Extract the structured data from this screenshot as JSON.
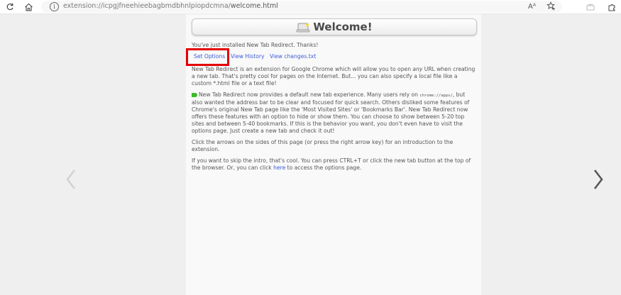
{
  "browser": {
    "url_prefix": "extension://icpgjfneehieebagbmdbhnlpiopdcmna/",
    "url_path": "welcome.html",
    "read_aloud_label": "Aᴬ"
  },
  "header": {
    "title": "Welcome!"
  },
  "intro": {
    "text": "You've just installed New Tab Redirect. Thanks!"
  },
  "links": {
    "set_options": "Set Options",
    "view_history": "View History",
    "view_changes": "View changes.txt"
  },
  "paragraphs": {
    "p1_a": "New Tab Redirect is an extension for Google Chrome which will allow you to open ",
    "p1_em": "any",
    "p1_b": " URL when creating a new tab. That's pretty cool for pages on the Internet. But... you can also specify a local file like a custom *.html file or a text file!",
    "p2_a": "New Tab Redirect now provides a default new tab experience. Many users rely on ",
    "p2_code": "chrome://apps/",
    "p2_b": ", but also wanted the address bar to be clear and focused for quick search. Others disliked some features of Chrome's original New Tab page like the 'Most Visited Sites' or 'Bookmarks Bar'. New Tab Redirect now offers these features with an option to hide or show them. You can choose to show between 5-20 top sites and between 5-40 bookmarks. If this is the behavior you want, you don't even have to visit the options page. Just create a new tab and check it out!",
    "p3": "Click the arrows on the sides of this page (or press the right arrow key) for an introduction to the extension.",
    "p4_a": "If you want to skip the intro, that's cool. You can press CTRL+T or click the new tab button at the top of the browser. Or, you can click ",
    "p4_link": "here",
    "p4_b": " to access the options page."
  },
  "colors": {
    "link": "#3b5bd6",
    "highlight": "#e40000",
    "panel_bg": "#f9f9f9",
    "page_bg": "#efefef"
  },
  "icons": {
    "back": "back-arrow-icon",
    "home": "home-icon",
    "info": "info-icon",
    "favorite": "star-add-icon",
    "collections": "collections-icon",
    "extensions": "puzzle-icon",
    "prev": "chevron-left-icon",
    "next": "chevron-right-icon",
    "welcome": "laptop-icon",
    "tag": "tag-icon"
  }
}
